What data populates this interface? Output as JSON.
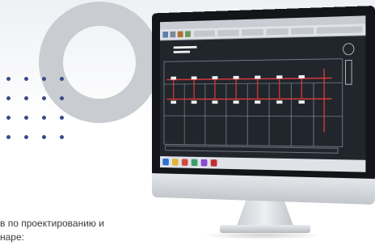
{
  "intro_text": {
    "line1": "в по проектированию и",
    "line2": "наре:"
  },
  "screen": {
    "app": "CAD drawing editor",
    "content": "electrical floor plan schematic"
  },
  "colors": {
    "dots": "#3c4a8a",
    "ring": "#c9ccd1",
    "schematic_lines": "#e03a3a",
    "cad_background": "#21252c"
  },
  "icons": [
    "decorative-dot-grid",
    "decorative-ring",
    "monitor",
    "taskbar-app-icons"
  ]
}
